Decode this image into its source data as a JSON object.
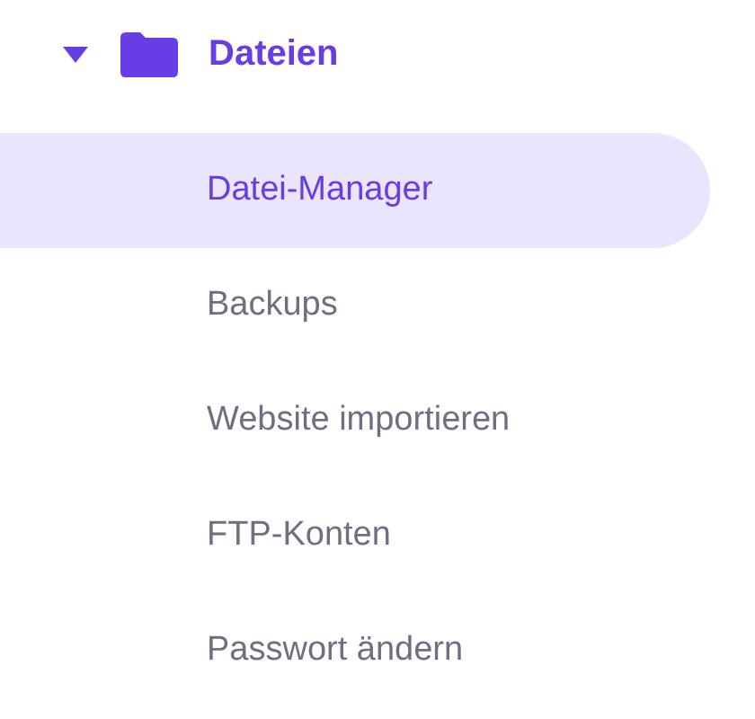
{
  "section": {
    "label": "Dateien",
    "expanded": true
  },
  "items": [
    {
      "label": "Datei-Manager",
      "selected": true
    },
    {
      "label": "Backups",
      "selected": false
    },
    {
      "label": "Website importieren",
      "selected": false
    },
    {
      "label": "FTP-Konten",
      "selected": false
    },
    {
      "label": "Passwort ändern",
      "selected": false
    }
  ]
}
